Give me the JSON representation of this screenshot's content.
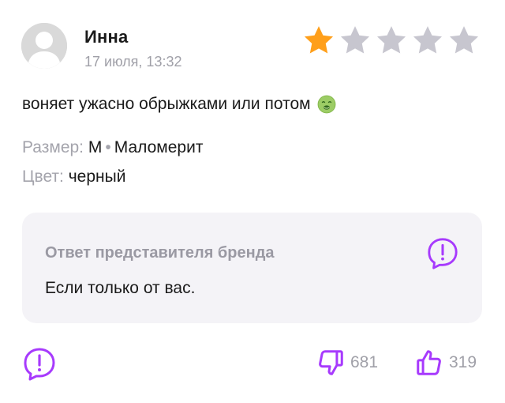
{
  "review": {
    "author": "Инна",
    "date": "17 июля, 13:32",
    "rating": 1,
    "max_rating": 5,
    "text": "воняет ужасно обрыжками или потом",
    "text_emoji": "nauseated-face-icon",
    "size_label": "Размер:",
    "size_value": "M",
    "fit_value": "Маломерит",
    "color_label": "Цвет:",
    "color_value": "черный"
  },
  "brand_reply": {
    "title": "Ответ представителя бренда",
    "text": "Если только от вас."
  },
  "votes": {
    "dislikes": "681",
    "likes": "319"
  },
  "colors": {
    "star_active": "#ff9f1a",
    "star_inactive": "#c7c6cf",
    "accent": "#a73afd",
    "reply_bg": "#f4f3f7"
  }
}
